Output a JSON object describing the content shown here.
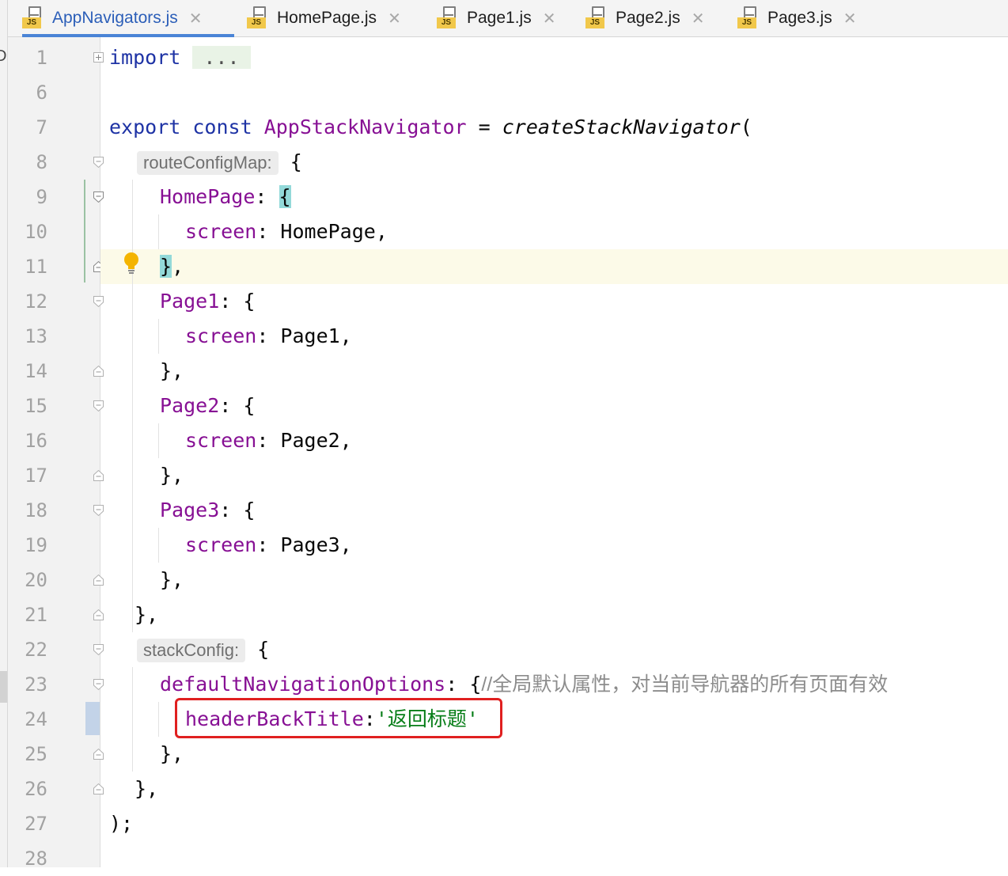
{
  "tabs": [
    {
      "label": "AppNavigators.js",
      "active": true
    },
    {
      "label": "HomePage.js",
      "active": false
    },
    {
      "label": "Page1.js",
      "active": false
    },
    {
      "label": "Page2.js",
      "active": false
    },
    {
      "label": "Page3.js",
      "active": false
    }
  ],
  "icons": {
    "file": "js-file-icon",
    "close": "close-icon",
    "fold": "fold-marker-icon",
    "intention": "lightbulb-icon"
  },
  "colors": {
    "keyword": "#1e33a5",
    "property": "#871094",
    "string": "#067d17",
    "comment": "#8c8c8c",
    "annotation_box": "#e02020",
    "active_tab": "#2b5eb8"
  },
  "left_panel_fragments": [
    "De",
    "t"
  ],
  "editor": {
    "line_numbers": [
      "1",
      "6",
      "7",
      "8",
      "9",
      "10",
      "11",
      "12",
      "13",
      "14",
      "15",
      "16",
      "17",
      "18",
      "19",
      "20",
      "21",
      "22",
      "23",
      "24",
      "25",
      "26",
      "27",
      "28"
    ],
    "lines": {
      "l1": {
        "kw": "import",
        "folded": "..."
      },
      "l7": {
        "kw1": "export",
        "kw2": "const",
        "name": "AppStackNavigator",
        "op": " = ",
        "fn": "createStackNavigator",
        "tail": "("
      },
      "l8": {
        "hint": "routeConfigMap:",
        "tail": "{"
      },
      "l9": {
        "key": "HomePage",
        "colon": ": ",
        "brace": "{"
      },
      "l10": {
        "key": "screen",
        "colon": ": ",
        "value": "HomePage,"
      },
      "l11": {
        "brace": "}",
        "tail": ","
      },
      "l12": {
        "key": "Page1",
        "colon": ": ",
        "tail": "{"
      },
      "l13": {
        "key": "screen",
        "colon": ": ",
        "value": "Page1,"
      },
      "l14": {
        "text": "},"
      },
      "l15": {
        "key": "Page2",
        "colon": ": ",
        "tail": "{"
      },
      "l16": {
        "key": "screen",
        "colon": ": ",
        "value": "Page2,"
      },
      "l17": {
        "text": "},"
      },
      "l18": {
        "key": "Page3",
        "colon": ": ",
        "tail": "{"
      },
      "l19": {
        "key": "screen",
        "colon": ": ",
        "value": "Page3,"
      },
      "l20": {
        "text": "},"
      },
      "l21": {
        "text": "},"
      },
      "l22": {
        "hint": "stackConfig:",
        "tail": "{"
      },
      "l23": {
        "key": "defaultNavigationOptions",
        "colon": ": ",
        "tail": "{",
        "comment": "//全局默认属性，对当前导航器的所有页面有效"
      },
      "l24": {
        "key": "headerBackTitle",
        "colon": ":",
        "string": "'返回标题'"
      },
      "l25": {
        "text": "},"
      },
      "l26": {
        "text": "},"
      },
      "l27": {
        "text": ");"
      }
    }
  }
}
